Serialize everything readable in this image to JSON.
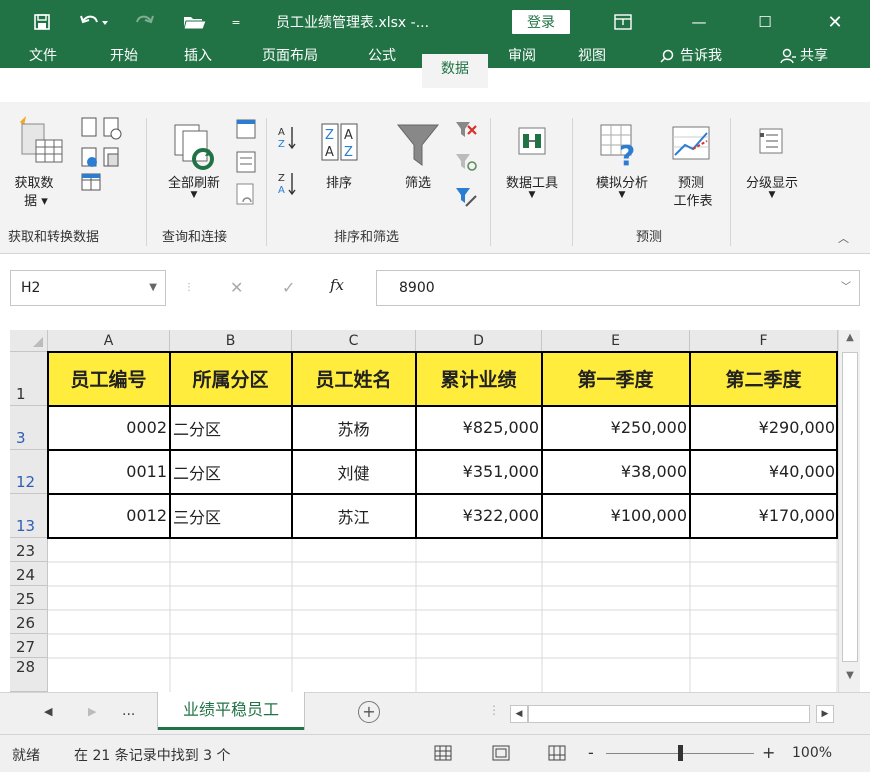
{
  "window": {
    "title": "员工业绩管理表.xlsx  -...",
    "login_label": "登录",
    "minimize_glyph": "—",
    "maximize_glyph": "☐",
    "close_glyph": "✕"
  },
  "quick_access": {
    "save_icon": "save-icon",
    "undo_icon": "undo-icon",
    "redo_icon": "redo-icon",
    "open_icon": "open-folder-icon",
    "more_glyph": "="
  },
  "tabs": [
    {
      "label": "文件"
    },
    {
      "label": "开始"
    },
    {
      "label": "插入"
    },
    {
      "label": "页面布局"
    },
    {
      "label": "公式"
    },
    {
      "label": "数据",
      "active": true
    },
    {
      "label": "审阅"
    },
    {
      "label": "视图"
    }
  ],
  "tell_me": "告诉我",
  "share": "共享",
  "ribbon": {
    "get_data_line1": "获取数",
    "get_data_line2": "据",
    "refresh_all": "全部刷新",
    "sort": "排序",
    "filter": "筛选",
    "data_tools": "数据工具",
    "what_if": "模拟分析",
    "forecast_line1": "预测",
    "forecast_line2": "工作表",
    "outline": "分级显示",
    "groups": {
      "get_transform": "获取和转换数据",
      "queries": "查询和连接",
      "sort_filter": "排序和筛选",
      "forecast": "预测"
    }
  },
  "formula_bar": {
    "name_box": "H2",
    "fx": "fx",
    "value": "8900"
  },
  "grid": {
    "columns": [
      "A",
      "B",
      "C",
      "D",
      "E",
      "F"
    ],
    "header_row_num": "1",
    "headers": [
      "员工编号",
      "所属分区",
      "员工姓名",
      "累计业绩",
      "第一季度",
      "第二季度"
    ],
    "rows": [
      {
        "num": "3",
        "cells": [
          "0002",
          "二分区",
          "苏杨",
          "¥825,000",
          "¥250,000",
          "¥290,000"
        ]
      },
      {
        "num": "12",
        "cells": [
          "0011",
          "二分区",
          "刘健",
          "¥351,000",
          "¥38,000",
          "¥40,000"
        ]
      },
      {
        "num": "13",
        "cells": [
          "0012",
          "三分区",
          "苏江",
          "¥322,000",
          "¥100,000",
          "¥170,000"
        ]
      }
    ],
    "empty_rows": [
      "23",
      "24",
      "25",
      "26",
      "27",
      "28"
    ]
  },
  "sheets": {
    "more": "...",
    "active_tab": "业绩平稳员工",
    "add_glyph": "+"
  },
  "status": {
    "ready": "就绪",
    "message": "在 21 条记录中找到 3 个",
    "zoom_minus": "-",
    "zoom_plus": "+",
    "zoom": "100%"
  },
  "colors": {
    "accent": "#217346",
    "header_fill": "#ffec3d",
    "filtered_row_number": "#2f5fb3"
  }
}
